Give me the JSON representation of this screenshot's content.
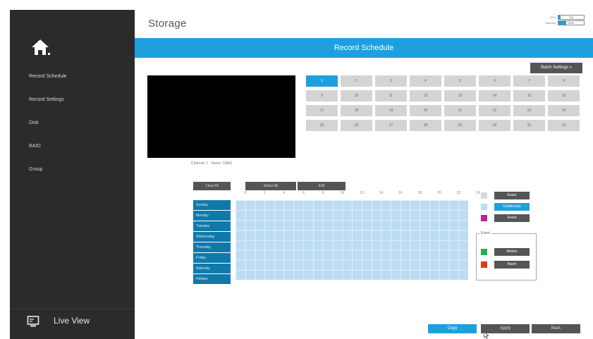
{
  "header": {
    "title": "Storage",
    "cpu_label": "CPU",
    "cpu_value": "7%",
    "cpu_fraction": 0.07,
    "memory_label": "Memory",
    "memory_value": "31%",
    "memory_fraction": 0.31
  },
  "sidebar": {
    "items": [
      {
        "label": "Record Schedule",
        "active": true
      },
      {
        "label": "Record Settings",
        "active": false
      },
      {
        "label": "Disk",
        "active": false
      },
      {
        "label": "RAID",
        "active": false
      },
      {
        "label": "Group",
        "active": false
      }
    ],
    "live_view_label": "Live View"
  },
  "banner": {
    "title": "Record Schedule"
  },
  "batch_settings_label": "Batch Settings",
  "channel_info": {
    "channel_label": "Channel: 1",
    "name_label": "Name: CAM1"
  },
  "channels": [
    "1",
    "2",
    "3",
    "4",
    "5",
    "6",
    "7",
    "8",
    "9",
    "10",
    "11",
    "12",
    "13",
    "14",
    "15",
    "16",
    "17",
    "18",
    "19",
    "20",
    "21",
    "22",
    "23",
    "24",
    "25",
    "26",
    "27",
    "28",
    "29",
    "30",
    "31",
    "32"
  ],
  "selected_channel": "1",
  "toolbar": {
    "clear_all": "Clear All",
    "select_all": "Select All",
    "edit": "Edit"
  },
  "hours": [
    "0",
    "2",
    "4",
    "6",
    "8",
    "10",
    "12",
    "14",
    "16",
    "18",
    "20",
    "22",
    "24"
  ],
  "days": [
    "Sunday",
    "Monday",
    "Tuesday",
    "Wednesday",
    "Thursday",
    "Friday",
    "Saturday",
    "Holiday"
  ],
  "legend": {
    "erase": "Erase",
    "continuous": "Continuous",
    "event": "Event",
    "event_group_title": "Event",
    "motion": "Motion",
    "alarm": "Alarm"
  },
  "colors": {
    "accent": "#1ea0de",
    "erase": "#d9d9d9",
    "continuous": "#bcdcf3",
    "event": "#b8268f",
    "motion": "#27ae4c",
    "alarm": "#e23a13"
  },
  "footer": {
    "copy": "Copy",
    "apply": "Apply",
    "back": "Back"
  }
}
